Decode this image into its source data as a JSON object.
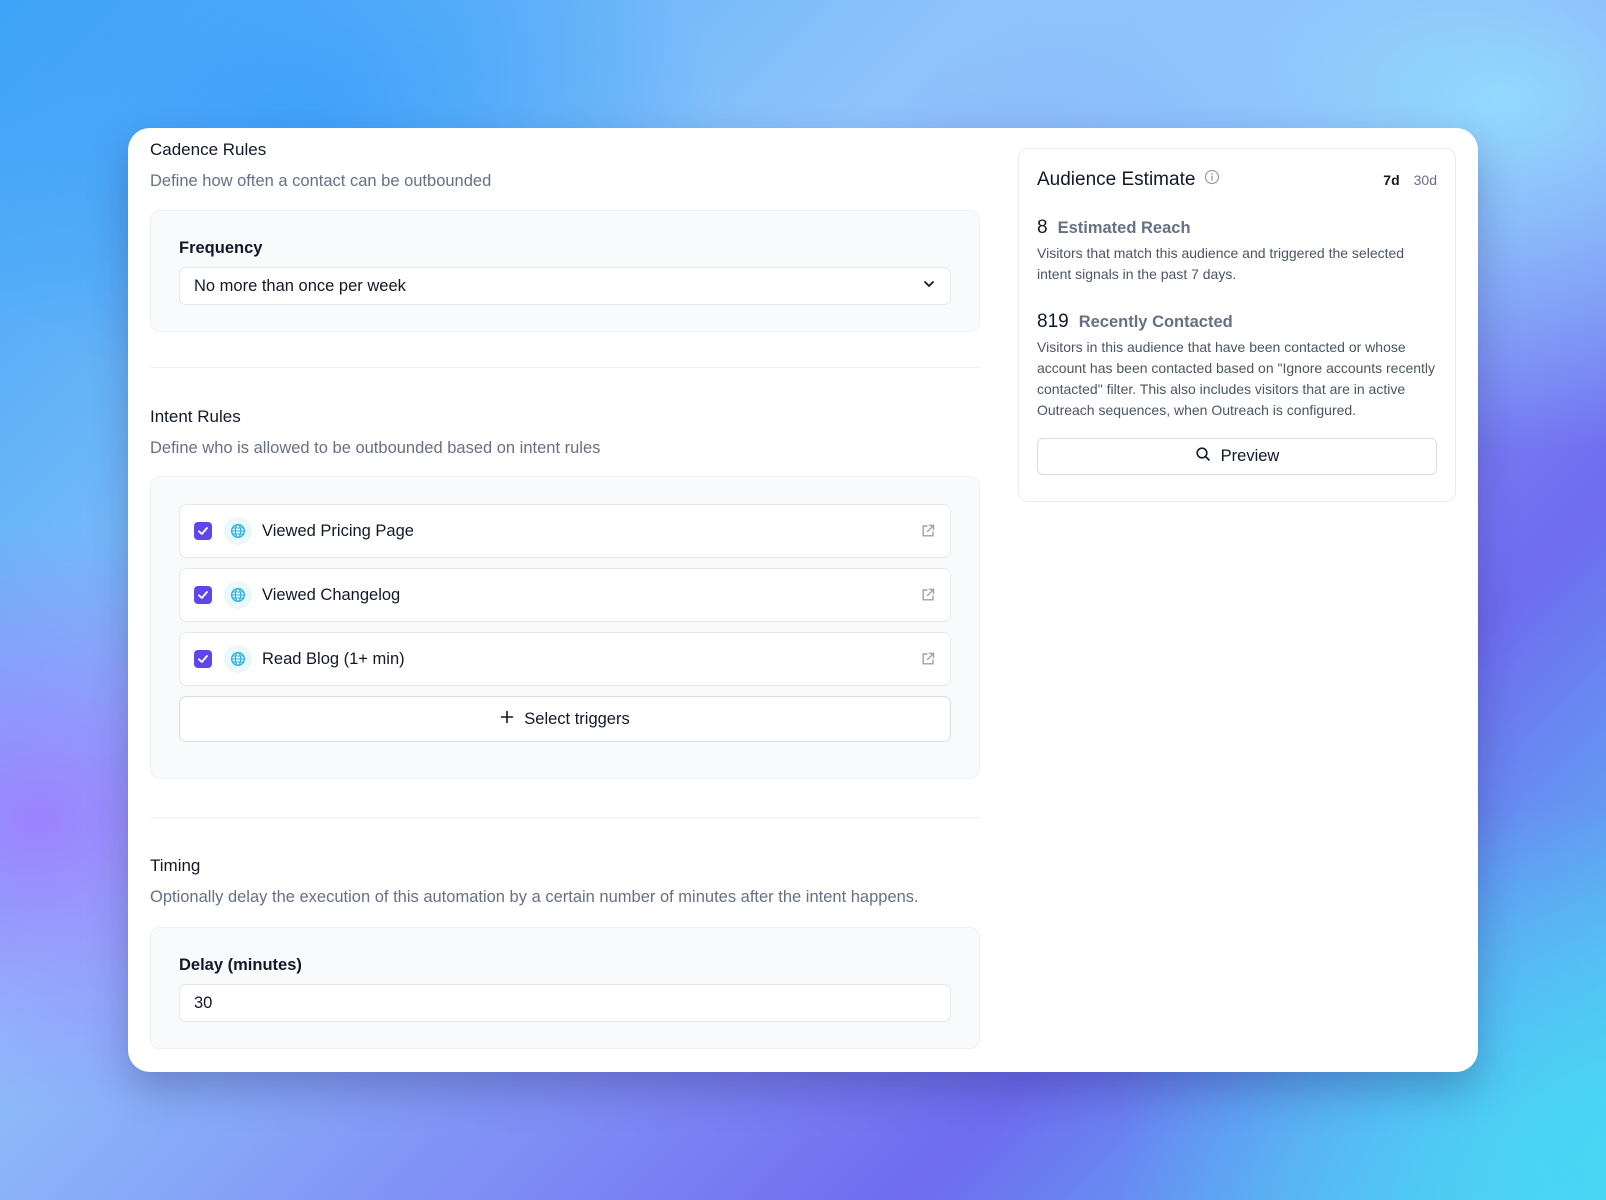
{
  "cadence": {
    "title": "Cadence Rules",
    "description": "Define how often a contact can be outbounded",
    "frequency_label": "Frequency",
    "frequency_value": "No more than once per week"
  },
  "intent": {
    "title": "Intent Rules",
    "description": "Define who is allowed to be outbounded based on intent rules",
    "triggers": [
      {
        "label": "Viewed Pricing Page",
        "checked": true
      },
      {
        "label": "Viewed Changelog",
        "checked": true
      },
      {
        "label": "Read Blog (1+ min)",
        "checked": true
      }
    ],
    "select_triggers_label": "Select triggers"
  },
  "timing": {
    "title": "Timing",
    "description": "Optionally delay the execution of this automation by a certain number of minutes after the intent happens.",
    "delay_label": "Delay (minutes)",
    "delay_value": "30"
  },
  "audience": {
    "title": "Audience Estimate",
    "ranges": [
      "7d",
      "30d"
    ],
    "active_range": "7d",
    "estimated_reach": {
      "value": "8",
      "label": "Estimated Reach",
      "description": "Visitors that match this audience and triggered the selected intent signals in the past 7 days."
    },
    "recently_contacted": {
      "value": "819",
      "label": "Recently Contacted",
      "description": "Visitors in this audience that have been contacted or whose account has been contacted based on \"Ignore accounts recently contacted\" filter. This also includes visitors that are in active Outreach sequences, when Outreach is configured."
    },
    "preview_label": "Preview"
  },
  "colors": {
    "checkbox": "#6046e8",
    "globe": "#2fb1d6"
  },
  "icons": [
    "chevron-down-icon",
    "globe-icon",
    "external-link-icon",
    "plus-icon",
    "info-icon",
    "search-icon",
    "check-icon"
  ]
}
